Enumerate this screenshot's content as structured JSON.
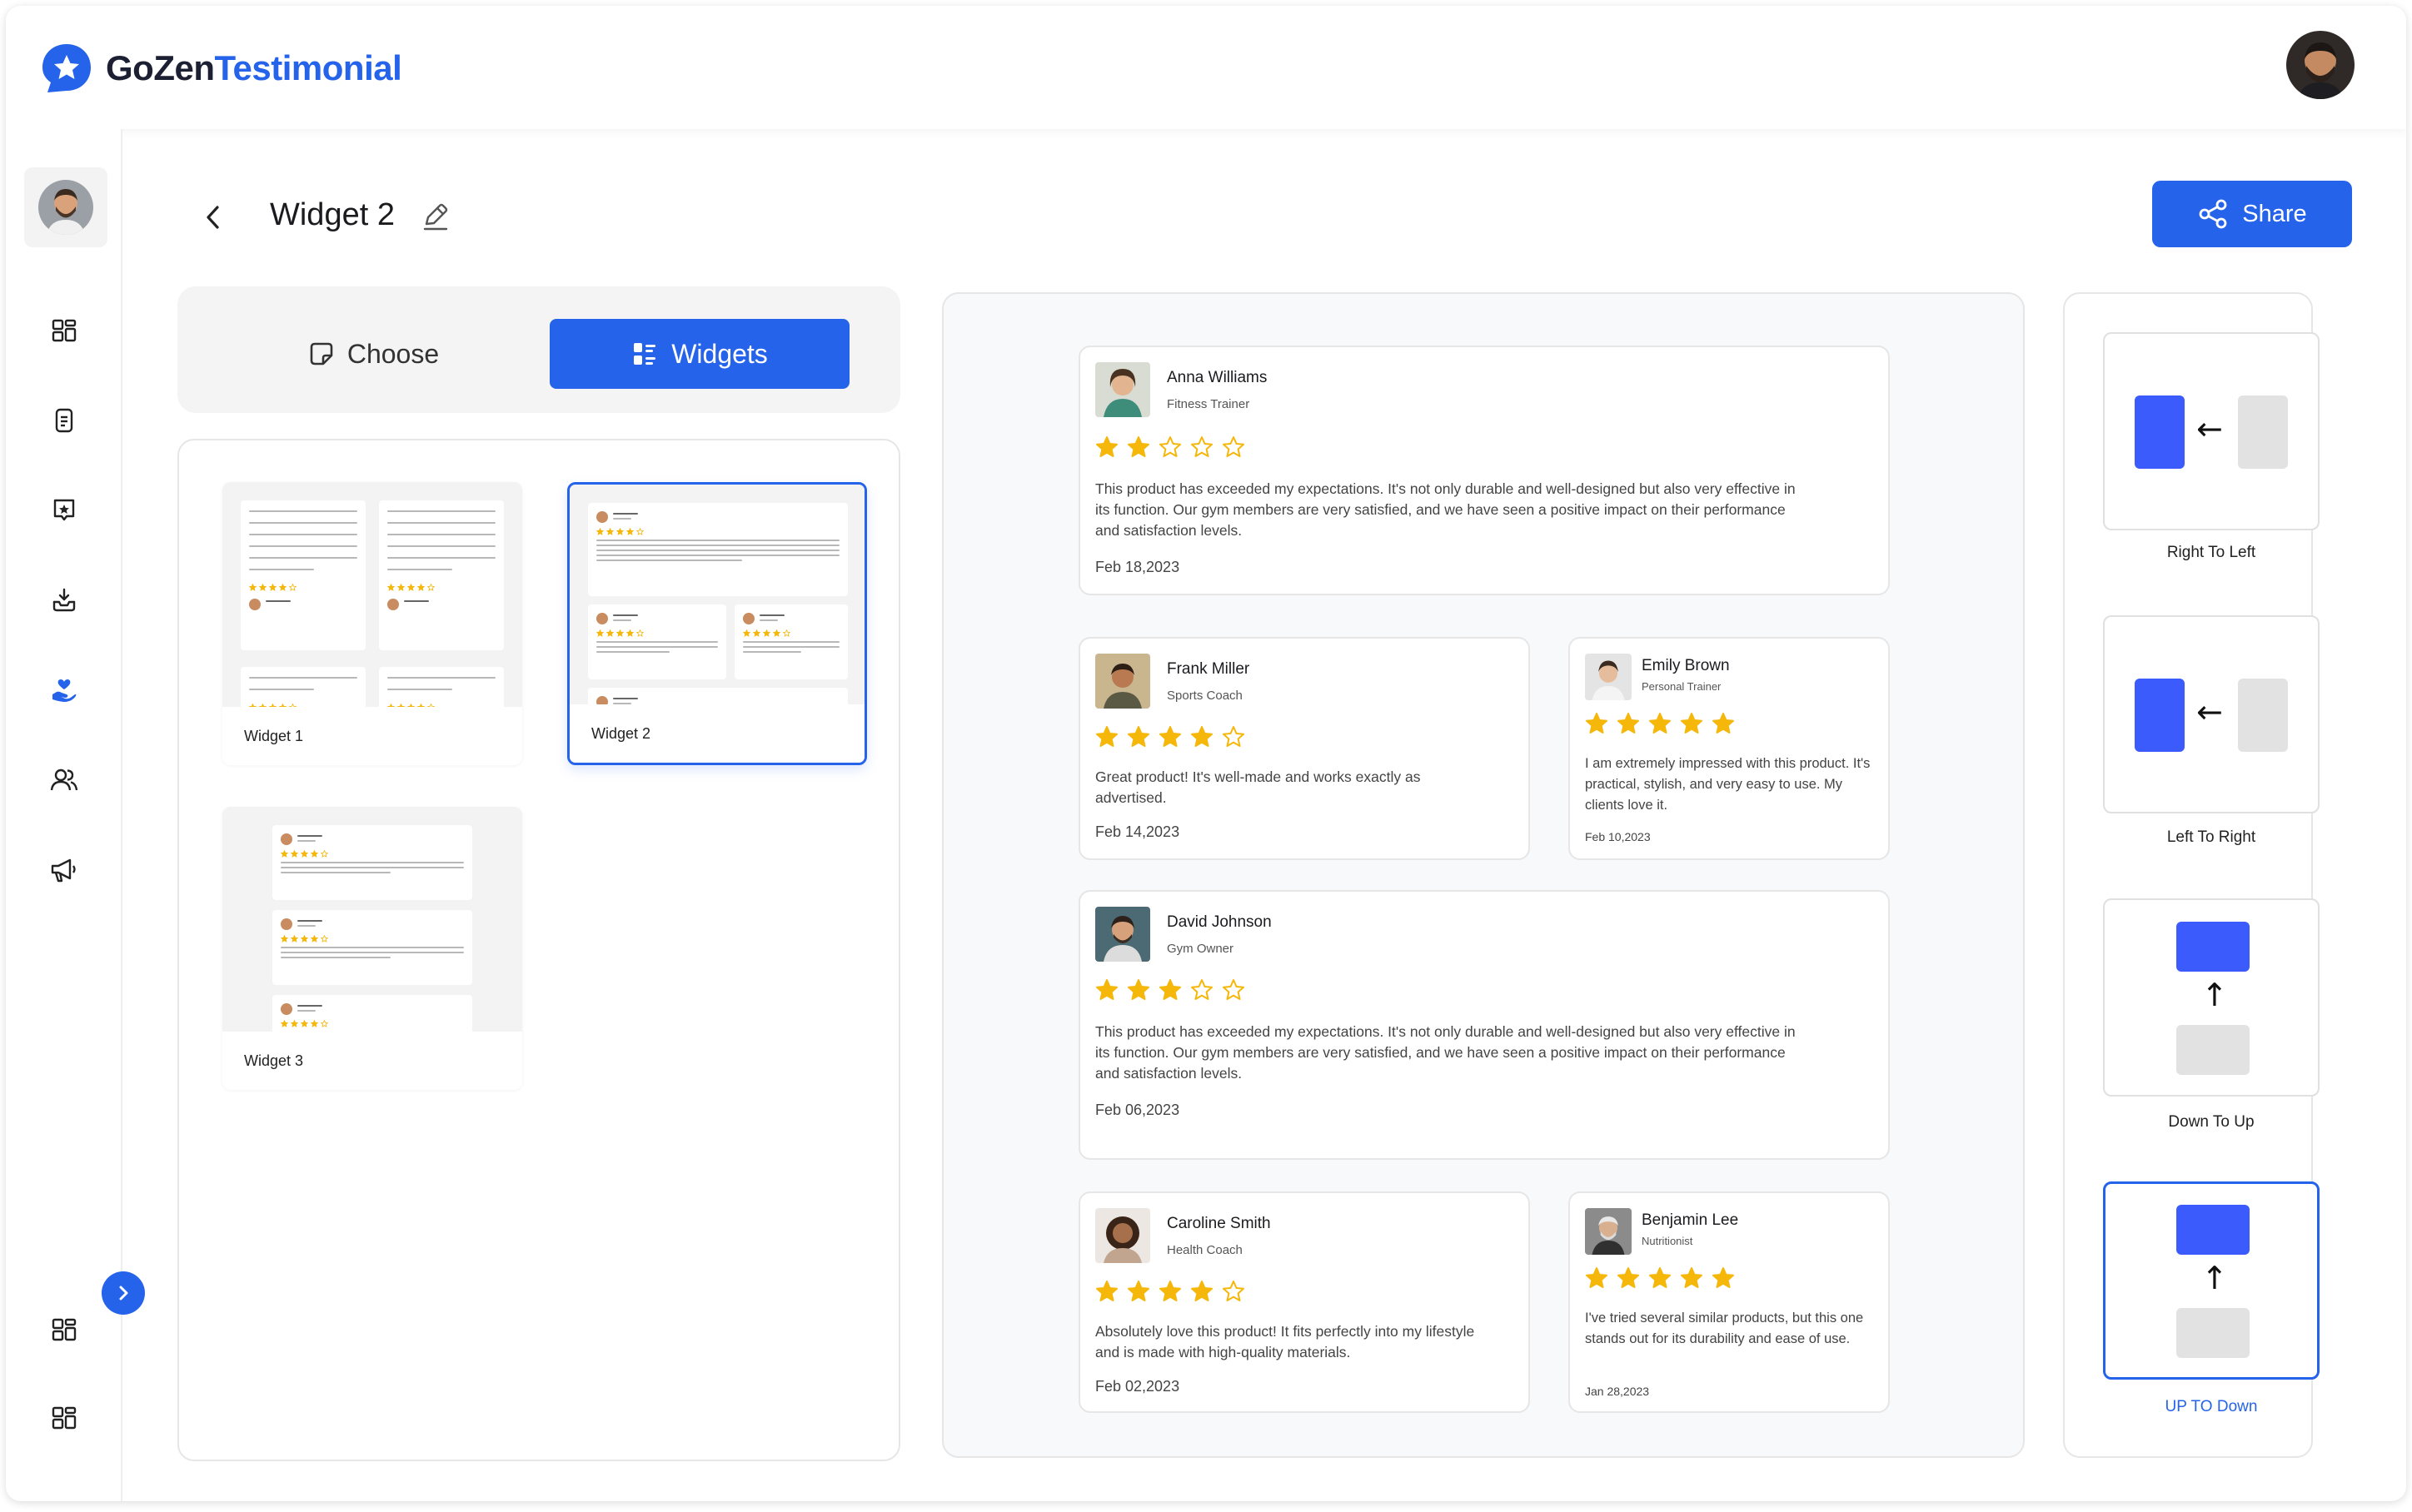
{
  "brand": {
    "name_part1": "GoZen",
    "name_part2": "Testimonial"
  },
  "header": {
    "title": "Widget 2",
    "share_label": "Share"
  },
  "tabs": {
    "choose_label": "Choose",
    "widgets_label": "Widgets"
  },
  "widgets": [
    {
      "label": "Widget 1"
    },
    {
      "label": "Widget 2"
    },
    {
      "label": "Widget 3"
    }
  ],
  "reviews": [
    {
      "name": "Anna Williams",
      "role": "Fitness Trainer",
      "rating": 2,
      "text": "This product has exceeded my expectations. It's not only durable and well-designed but also very effective in its function. Our gym members are very satisfied, and we have seen a positive impact on their performance and satisfaction levels.",
      "date": "Feb 18,2023"
    },
    {
      "name": "Frank Miller",
      "role": "Sports Coach",
      "rating": 4,
      "text": "Great product! It's well-made and works exactly as advertised.",
      "date": "Feb 14,2023"
    },
    {
      "name": "Emily Brown",
      "role": "Personal Trainer",
      "rating": 5,
      "text": "I am extremely impressed with this product. It's practical, stylish, and very easy to use. My clients love it.",
      "date": "Feb 10,2023"
    },
    {
      "name": "David Johnson",
      "role": "Gym Owner",
      "rating": 3,
      "text": "This product has exceeded my expectations. It's not only durable and well-designed but also very effective in its function. Our gym members are very satisfied, and we have seen a positive impact on their performance and satisfaction levels.",
      "date": "Feb 06,2023"
    },
    {
      "name": "Caroline Smith",
      "role": "Health Coach",
      "rating": 4,
      "text": "Absolutely love this product! It fits perfectly into my lifestyle and is made with high-quality materials.",
      "date": "Feb 02,2023"
    },
    {
      "name": "Benjamin Lee",
      "role": "Nutritionist",
      "rating": 5,
      "text": "I've tried several similar products, but this one stands out for its durability and ease of use.",
      "date": "Jan 28,2023"
    }
  ],
  "animations": [
    {
      "label": "Right To Left",
      "selected": false
    },
    {
      "label": "Left To Right",
      "selected": false
    },
    {
      "label": "Down To Up",
      "selected": false
    },
    {
      "label": "UP TO Down",
      "selected": true
    }
  ],
  "icons": {
    "nav": [
      "dashboard-icon",
      "document-icon",
      "star-badge-icon",
      "download-tray-icon",
      "hand-heart-icon",
      "users-icon",
      "megaphone-icon"
    ],
    "bottom": [
      "grid-icon",
      "grid-icon"
    ]
  },
  "colors": {
    "accent": "#2563eb",
    "star": "#f5b70a",
    "anim_block": "#3b5bfd"
  }
}
